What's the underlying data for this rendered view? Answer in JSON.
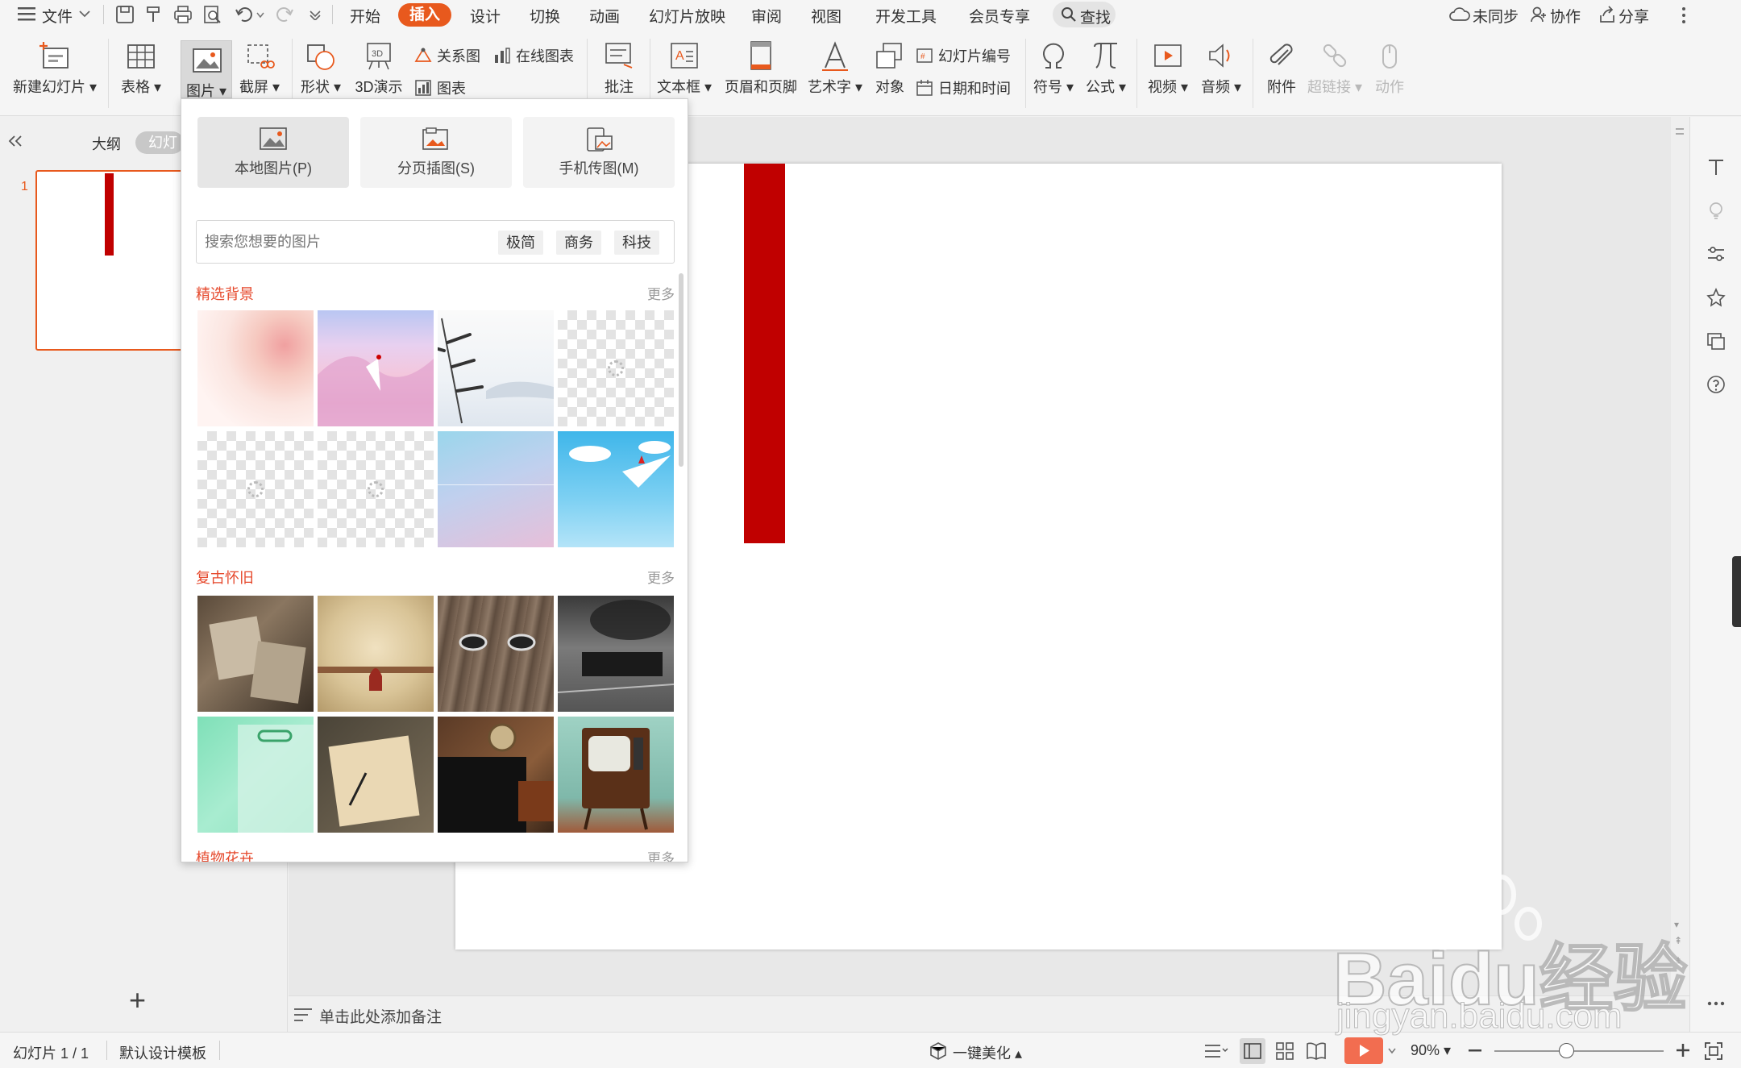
{
  "menu": {
    "file": "文件",
    "tabs": [
      "开始",
      "插入",
      "设计",
      "切换",
      "动画",
      "幻灯片放映",
      "审阅",
      "视图",
      "开发工具",
      "会员专享"
    ],
    "search": "查找",
    "right": {
      "sync": "未同步",
      "collab": "协作",
      "share": "分享"
    }
  },
  "ribbon": {
    "new_slide": "新建幻灯片",
    "table": "表格",
    "picture": "图片",
    "screenshot": "截屏",
    "shape": "形状",
    "demo3d": "3D演示",
    "relation": "关系图",
    "online_chart": "在线图表",
    "chart": "图表",
    "comment": "批注",
    "textbox": "文本框",
    "header_footer": "页眉和页脚",
    "wordart": "艺术字",
    "object": "对象",
    "slide_number": "幻灯片编号",
    "datetime": "日期和时间",
    "symbol": "符号",
    "formula": "公式",
    "video": "视频",
    "audio": "音频",
    "attachment": "附件",
    "hyperlink": "超链接",
    "action": "动作"
  },
  "left_panel": {
    "tab_outline": "大纲",
    "tab_slides": "幻灯",
    "slide_index": "1",
    "add_symbol": "+"
  },
  "picture_dropdown": {
    "sources": [
      "本地图片(P)",
      "分页插图(S)",
      "手机传图(M)"
    ],
    "search_placeholder": "搜索您想要的图片",
    "tags": [
      "极简",
      "商务",
      "科技"
    ],
    "section1": {
      "title": "精选背景",
      "more": "更多"
    },
    "section2": {
      "title": "复古怀旧",
      "more": "更多"
    },
    "section3": {
      "title": "植物花卉",
      "more": "更多"
    }
  },
  "notes": {
    "placeholder": "单击此处添加备注"
  },
  "status": {
    "slide_count": "幻灯片 1 / 1",
    "template": "默认设计模板",
    "beautify": "一键美化",
    "zoom": "90%"
  },
  "watermark": {
    "brand": "Baidu经验",
    "url": "jingyan.baidu.com"
  },
  "colors": {
    "accent": "#e8591d",
    "slide_bar": "#c00000",
    "section_title": "#e64a2e"
  }
}
